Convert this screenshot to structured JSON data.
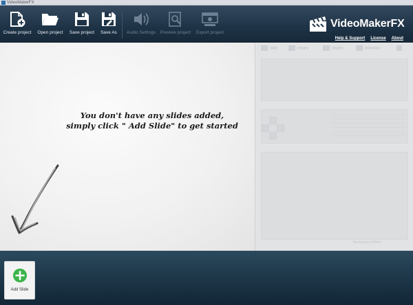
{
  "window": {
    "title": "VideoMakerFX"
  },
  "toolbar": {
    "buttons": [
      {
        "label": "Create project",
        "icon": "new-document-icon",
        "enabled": true
      },
      {
        "label": "Open project",
        "icon": "folder-open-icon",
        "enabled": true
      },
      {
        "label": "Save project",
        "icon": "floppy-disk-icon",
        "enabled": true
      },
      {
        "label": "Save As",
        "icon": "floppy-disk-edit-icon",
        "enabled": true
      },
      {
        "label": "Audio Settings",
        "icon": "speaker-icon",
        "enabled": false
      },
      {
        "label": "Preview project",
        "icon": "magnifier-icon",
        "enabled": false
      },
      {
        "label": "Export project",
        "icon": "export-film-icon",
        "enabled": false
      }
    ]
  },
  "brand": {
    "name": "VideoMakerFX",
    "links": {
      "help": "Help & Support",
      "license": "License",
      "about": "About"
    }
  },
  "stage": {
    "empty_line1": "You don't have any slides added,",
    "empty_line2": "simply click \" Add Slide\" to get started"
  },
  "panel": {
    "tabs": [
      "Slide",
      "Images",
      "Shapes",
      "Animation"
    ],
    "bottom_button": "Background Effect"
  },
  "slidebar": {
    "add_slide_label": "Add Slide"
  },
  "colors": {
    "toolbar": "#1e3346",
    "slidebar": "#1c3547",
    "add_green": "#3cb44a",
    "disabled_text": "#6f8295"
  }
}
